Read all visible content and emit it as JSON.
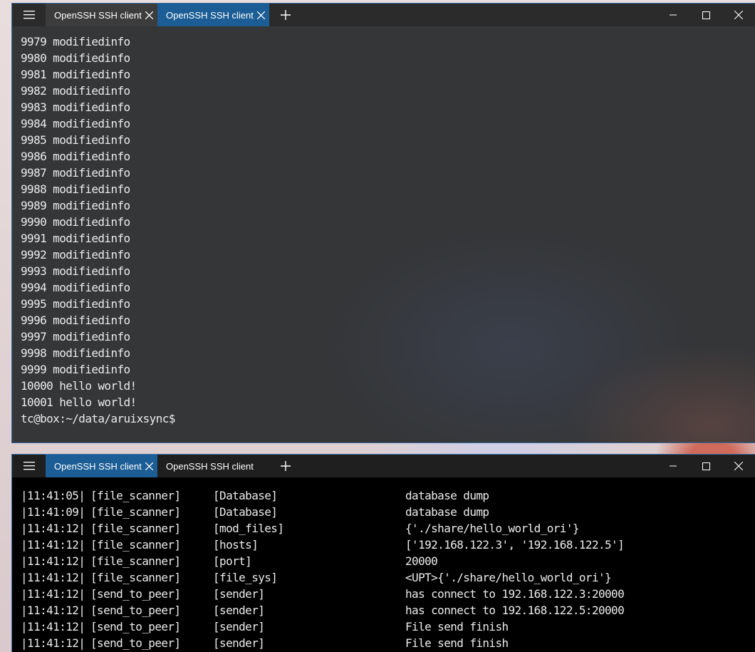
{
  "top_window": {
    "tabs": [
      {
        "label": "OpenSSH SSH client",
        "active": false
      },
      {
        "label": "OpenSSH SSH client",
        "active": true
      }
    ],
    "lines": [
      "9979 modifiedinfo",
      "9980 modifiedinfo",
      "9981 modifiedinfo",
      "9982 modifiedinfo",
      "9983 modifiedinfo",
      "9984 modifiedinfo",
      "9985 modifiedinfo",
      "9986 modifiedinfo",
      "9987 modifiedinfo",
      "9988 modifiedinfo",
      "9989 modifiedinfo",
      "9990 modifiedinfo",
      "9991 modifiedinfo",
      "9992 modifiedinfo",
      "9993 modifiedinfo",
      "9994 modifiedinfo",
      "9995 modifiedinfo",
      "9996 modifiedinfo",
      "9997 modifiedinfo",
      "9998 modifiedinfo",
      "9999 modifiedinfo",
      "10000 hello world!",
      "10001 hello world!",
      "tc@box:~/data/aruixsync$"
    ]
  },
  "bottom_window": {
    "tabs": [
      {
        "label": "OpenSSH SSH client",
        "active": true
      },
      {
        "label": "OpenSSH SSH client",
        "active": false
      }
    ],
    "log_rows": [
      [
        "|11:41:05|",
        "[file_scanner]",
        "[Database]",
        "database dump"
      ],
      [
        "|11:41:09|",
        "[file_scanner]",
        "[Database]",
        "database dump"
      ],
      [
        "|11:41:12|",
        "[file_scanner]",
        "[mod_files]",
        "{'./share/hello_world_ori'}"
      ],
      [
        "|11:41:12|",
        "[file_scanner]",
        "[hosts]",
        "['192.168.122.3', '192.168.122.5']"
      ],
      [
        "|11:41:12|",
        "[file_scanner]",
        "[port]",
        "20000"
      ],
      [
        "|11:41:12|",
        "[file_scanner]",
        "[file_sys]",
        "<UPT>{'./share/hello_world_ori'}"
      ],
      [
        "|11:41:12|",
        "[send_to_peer]",
        "[sender]",
        "has connect to 192.168.122.3:20000"
      ],
      [
        "|11:41:12|",
        "[send_to_peer]",
        "[sender]",
        "has connect to 192.168.122.5:20000"
      ],
      [
        "|11:41:12|",
        "[send_to_peer]",
        "[sender]",
        "File send finish"
      ],
      [
        "|11:41:12|",
        "[send_to_peer]",
        "[sender]",
        "File send finish"
      ]
    ]
  },
  "icons": {
    "menu": "hamburger-menu-icon",
    "close_tab": "close-icon",
    "new_tab": "plus-icon",
    "minimize": "minimize-icon",
    "maximize": "maximize-icon",
    "close_window": "close-window-icon"
  }
}
